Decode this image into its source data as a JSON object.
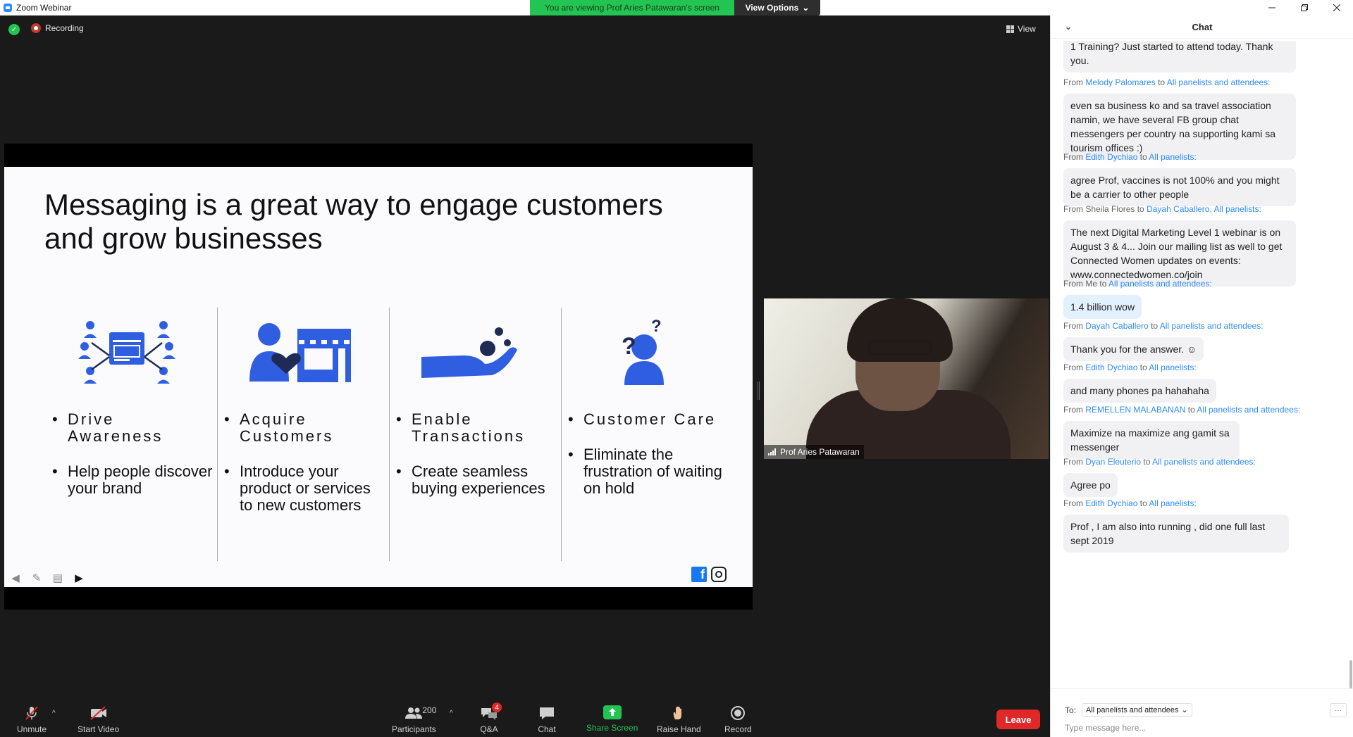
{
  "window": {
    "title": "Zoom Webinar",
    "viewing_banner": "You are viewing Prof Aries Patawaran's screen",
    "view_options": "View Options"
  },
  "meeting": {
    "recording_label": "Recording",
    "view_label": "View"
  },
  "slide": {
    "title_line1": "Messaging is a great way to engage customers",
    "title_line2": "and grow businesses",
    "pillars": [
      {
        "heading": "Drive Awareness",
        "description": "Help people discover your brand"
      },
      {
        "heading": "Acquire Customers",
        "description": "Introduce your product or services to new customers"
      },
      {
        "heading": "Enable Transactions",
        "description": "Create seamless buying experiences"
      },
      {
        "heading": "Customer Care",
        "description": "Eliminate the frustration of waiting on hold"
      }
    ],
    "facebook_glyph": "f",
    "accent_color": "#2f5fe0"
  },
  "video": {
    "name": "Prof Aries Patawaran"
  },
  "toolbar": {
    "unmute": "Unmute",
    "start_video": "Start Video",
    "participants": "Participants",
    "participants_count": "200",
    "qa": "Q&A",
    "qa_badge": "4",
    "chat": "Chat",
    "share_screen": "Share Screen",
    "raise_hand": "Raise Hand",
    "record": "Record",
    "leave": "Leave"
  },
  "chat": {
    "title": "Chat",
    "to_label": "To:",
    "to_value": "All panelists and attendees",
    "placeholder": "Type message here...",
    "more": "···",
    "partial_top": "1 Training? Just started to attend today. Thank you.",
    "messages": [
      {
        "from": "Melody Palomares",
        "connector": "to",
        "target": "All panelists and attendees:",
        "text": "even sa business ko and sa travel association namin, we have several FB group chat messengers per country na supporting kami sa tourism offices :)"
      },
      {
        "from": "Edith Dychiao",
        "connector": "to",
        "target": "All panelists:",
        "text": "agree Prof, vaccines is not 100% and you might be a carrier to other people"
      },
      {
        "from": "Sheila  Flores",
        "connector": "to",
        "target": "Dayah Caballero, All panelists:",
        "text": "The next Digital Marketing Level 1 webinar is on August 3 & 4... Join our mailing list as well to get Connected Women updates on events: www.connectedwomen.co/join",
        "from_plain": true
      },
      {
        "from": "Me",
        "connector": "to",
        "target": "All panelists and attendees:",
        "text": "1.4 billion wow",
        "from_plain": true,
        "mine": true
      },
      {
        "from": "Dayah Caballero",
        "connector": "to",
        "target": "All panelists and attendees:",
        "text": "Thank you for the answer. ☺"
      },
      {
        "from": "Edith Dychiao",
        "connector": "to",
        "target": "All panelists:",
        "text": "and many phones pa hahahaha"
      },
      {
        "from": "REMELLEN MALABANAN",
        "connector": "to",
        "target": "All panelists and attendees:",
        "text": "Maximize na maximize ang gamit sa messenger"
      },
      {
        "from": "Dyan Eleuterio",
        "connector": "to",
        "target": "All panelists and attendees:",
        "text": "Agree po"
      },
      {
        "from": "Edith Dychiao",
        "connector": "to",
        "target": "All panelists:",
        "text": "Prof , I am also into running , did one full last sept 2019"
      }
    ]
  }
}
